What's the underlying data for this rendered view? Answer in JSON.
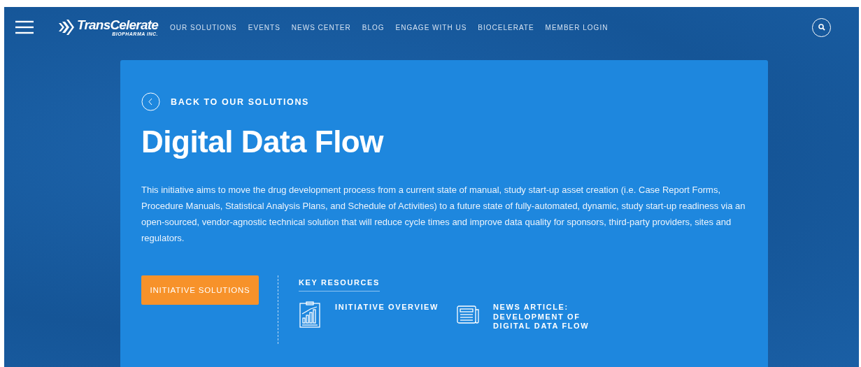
{
  "header": {
    "logo": {
      "name": "TransCelerate",
      "tagline": "BIOPHARMA INC."
    },
    "nav": [
      "OUR SOLUTIONS",
      "EVENTS",
      "NEWS CENTER",
      "BLOG",
      "ENGAGE WITH US",
      "BIOCELERATE",
      "MEMBER LOGIN"
    ]
  },
  "hero": {
    "back_link": "BACK TO OUR SOLUTIONS",
    "title": "Digital Data Flow",
    "description": "This initiative aims to move the drug development process from a current state of manual, study start-up asset creation (i.e. Case Report Forms, Procedure Manuals, Statistical Analysis Plans, and Schedule of Activities) to a future state of fully-automated, dynamic, study start-up readiness via an open-sourced, vendor-agnostic technical solution that will reduce cycle times and improve data quality for sponsors, third-party providers, sites and regulators.",
    "button": "INITIATIVE SOLUTIONS",
    "key_resources": {
      "heading": "KEY RESOURCES",
      "items": [
        {
          "kind": "report",
          "label": "INITIATIVE OVERVIEW"
        },
        {
          "kind": "news",
          "label": "NEWS ARTICLE: DEVELOPMENT OF DIGITAL DATA FLOW"
        }
      ]
    }
  }
}
